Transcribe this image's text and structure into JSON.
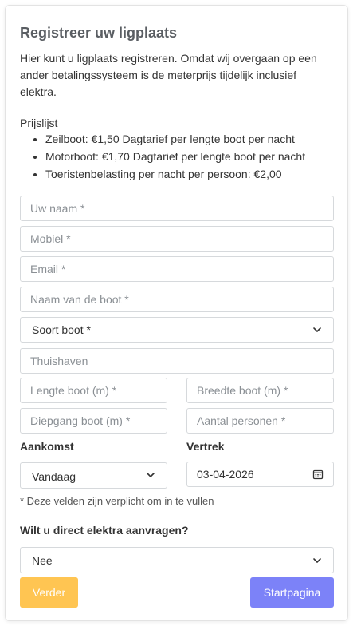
{
  "header": {
    "title": "Registreer uw ligplaats",
    "intro": "Hier kunt u ligplaats registreren. Omdat wij overgaan op een ander betalingssysteem is de meterprijs tijdelijk inclusief elektra."
  },
  "prijslijst": {
    "title": "Prijslijst",
    "items": [
      "Zeilboot: €1,50 Dagtarief per lengte boot per nacht",
      "Motorboot: €1,70 Dagtarief per lengte boot per nacht",
      "Toeristenbelasting per nacht per persoon: €2,00"
    ]
  },
  "form": {
    "name_placeholder": "Uw naam *",
    "mobile_placeholder": "Mobiel *",
    "email_placeholder": "Email *",
    "boat_name_placeholder": "Naam van de boot *",
    "boat_type_value": "Soort boot *",
    "home_port_placeholder": "Thuishaven",
    "length_placeholder": "Lengte boot (m) *",
    "width_placeholder": "Breedte boot (m) *",
    "draught_placeholder": "Diepgang boot (m) *",
    "persons_placeholder": "Aantal personen *",
    "arrival_label": "Aankomst",
    "arrival_value": "Vandaag",
    "departure_label": "Vertrek",
    "departure_value": "03-04-2026",
    "required_note": "* Deze velden zijn verplicht om in te vullen",
    "elektra_label": "Wilt u direct elektra aanvragen?",
    "elektra_value": "Nee"
  },
  "buttons": {
    "next_label": "Verder",
    "home_label": "Startpagina"
  },
  "colors": {
    "next_button": "#ffc552",
    "home_button": "#7c82f8",
    "title": "#5a5e63"
  },
  "icons": {
    "select": "chevron-down-icon",
    "date": "calendar-icon"
  }
}
